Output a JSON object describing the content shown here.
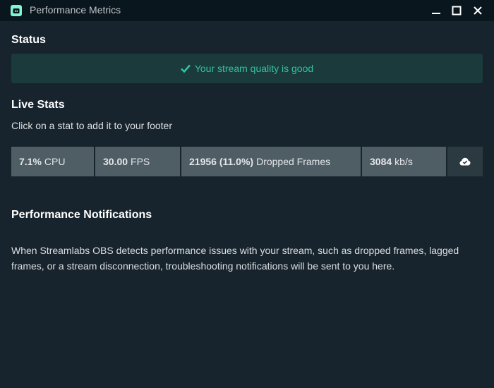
{
  "window": {
    "title": "Performance Metrics",
    "icons": [
      "streamlabs-logo-icon",
      "minimize-icon",
      "maximize-icon",
      "close-icon"
    ]
  },
  "status": {
    "heading": "Status",
    "message": "Your stream quality is good",
    "icon": "check-icon"
  },
  "live_stats": {
    "heading": "Live Stats",
    "subtitle": "Click on a stat to add it to your footer",
    "cpu": {
      "value": "7.1%",
      "label": "CPU"
    },
    "fps": {
      "value": "30.00",
      "label": "FPS"
    },
    "dropped": {
      "value": "21956 (11.0%)",
      "label": "Dropped Frames"
    },
    "bandwidth": {
      "value": "3084",
      "label": "kb/s"
    },
    "extra_icon": "cloud-check-icon"
  },
  "notifications": {
    "heading": "Performance Notifications",
    "text": "When Streamlabs OBS detects performance issues with your stream, such as dropped frames, lagged frames, or a stream disconnection, troubleshooting notifications will be sent to you here."
  },
  "colors": {
    "background": "#17242d",
    "titlebar": "#09161d",
    "accent": "#31c3a2",
    "status_bg": "#1a3a3b",
    "stat_bg": "#4f5e65"
  }
}
